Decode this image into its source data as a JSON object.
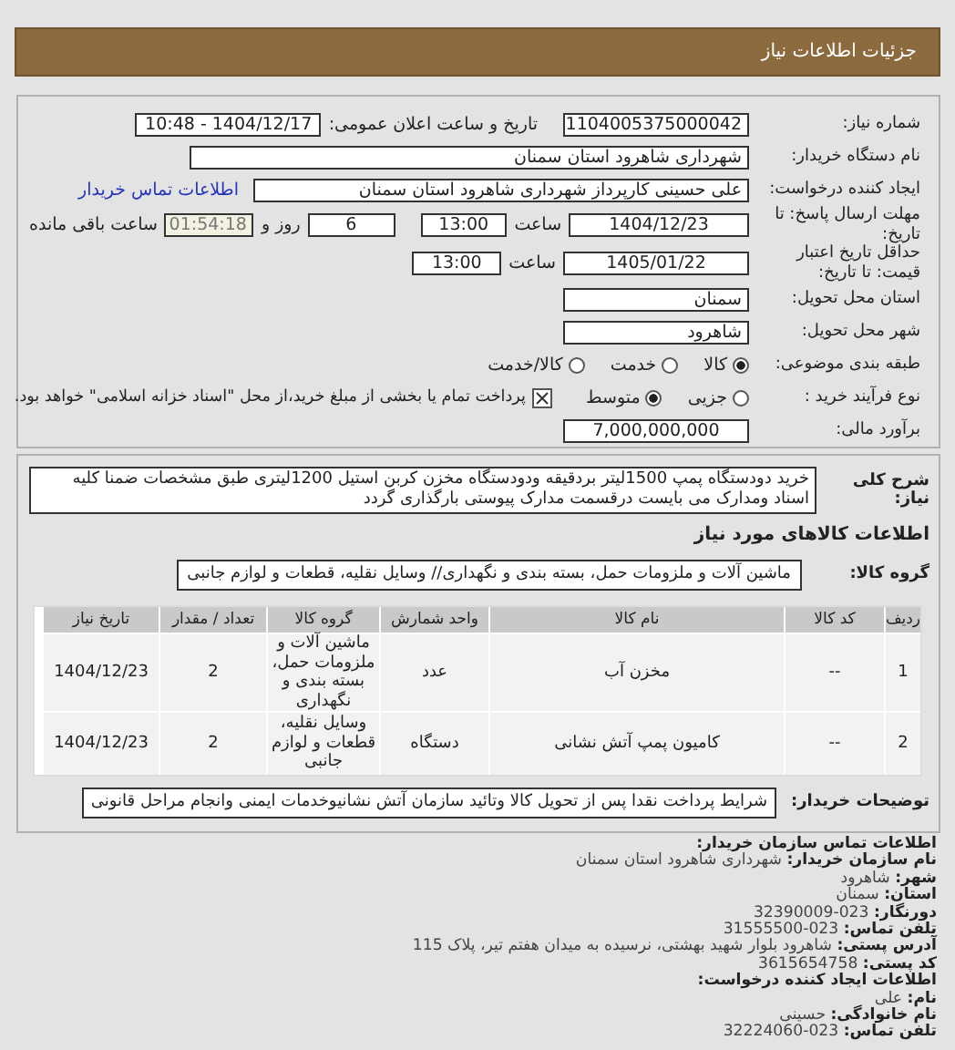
{
  "header": {
    "title": "جزئیات اطلاعات نیاز"
  },
  "need_number": {
    "label": "شماره نیاز:",
    "value": "1104005375000042"
  },
  "announce": {
    "label": "تاریخ و ساعت اعلان عمومی:",
    "value": "1404/12/17 - 10:48"
  },
  "buyer": {
    "label": "نام دستگاه خریدار:",
    "value": "شهرداری شاهرود استان سمنان"
  },
  "requester": {
    "label": "ایجاد کننده درخواست:",
    "value": "علی حسینی کارپرداز شهرداری شاهرود استان سمنان",
    "link": "اطلاعات تماس خریدار"
  },
  "deadline": {
    "label": "مهلت ارسال پاسخ: تا تاریخ:",
    "date": "1404/12/23",
    "time_label": "ساعت",
    "time": "13:00",
    "days": "6",
    "days_label": "روز و",
    "remaining": "01:54:18",
    "remaining_label": "ساعت باقی مانده"
  },
  "validity": {
    "label": "حداقل تاریخ اعتبار قیمت: تا تاریخ:",
    "date": "1405/01/22",
    "time_label": "ساعت",
    "time": "13:00"
  },
  "province": {
    "label": "استان محل تحویل:",
    "value": "سمنان"
  },
  "city": {
    "label": "شهر محل تحویل:",
    "value": "شاهرود"
  },
  "category": {
    "label": "طبقه بندی موضوعی:",
    "options": [
      {
        "label": "کالا",
        "selected": true
      },
      {
        "label": "خدمت",
        "selected": false
      },
      {
        "label": "کالا/خدمت",
        "selected": false
      }
    ]
  },
  "process": {
    "label": "نوع فرآیند خرید :",
    "options": [
      {
        "label": "جزیی",
        "selected": false
      },
      {
        "label": "متوسط",
        "selected": true
      }
    ],
    "treasury": {
      "checked": true,
      "label": "پرداخت تمام یا بخشی از مبلغ خرید،از محل \"اسناد خزانه اسلامی\" خواهد بود."
    }
  },
  "budget": {
    "label": "برآورد مالی:",
    "value": "7,000,000,000"
  },
  "description": {
    "label": "شرح کلی نیاز:",
    "value": "خرید دودستگاه پمپ 1500لیتر بردقیقه ودودستگاه مخزن کربن استیل 1200لیتری طبق مشخصات ضمنا کلیه اسناد ومدارک می بایست درقسمت مدارک پیوستی بارگذاری گردد"
  },
  "goods_heading": "اطلاعات کالاهای مورد نیاز",
  "goods_group": {
    "label": "گروه کالا:",
    "value": "ماشین آلات و ملزومات حمل، بسته بندی و نگهداری// وسایل نقلیه، قطعات و لوازم جانبی"
  },
  "table": {
    "columns": [
      "ردیف",
      "کد کالا",
      "نام کالا",
      "واحد شمارش",
      "گروه کالا",
      "تعداد / مقدار",
      "تاریخ نیاز"
    ],
    "rows": [
      [
        "1",
        "--",
        "مخزن آب",
        "عدد",
        "ماشین آلات و ملزومات حمل، بسته بندی و نگهداری",
        "2",
        "1404/12/23"
      ],
      [
        "2",
        "--",
        "کامیون پمپ آتش نشانی",
        "دستگاه",
        "وسایل نقلیه، قطعات و لوازم جانبی",
        "2",
        "1404/12/23"
      ]
    ]
  },
  "notes": {
    "label": "توضیحات خریدار:",
    "value": "شرایط پرداخت نقدا پس از تحویل کالا وتائید سازمان آتش نشانیوخدمات ایمنی وانجام مراحل قانونی"
  },
  "contact": [
    {
      "kind": "heading",
      "text": "اطلاعات تماس سازمان خریدار:"
    },
    {
      "kind": "item",
      "text": "**نام سازمان خریدار:** شهرداری شاهرود استان سمنان"
    },
    {
      "kind": "item",
      "text": "**شهر:** شاهرود"
    },
    {
      "kind": "item",
      "text": "**استان:** سمنان"
    },
    {
      "kind": "item",
      "text": "**دورنگار:** 023-32390009"
    },
    {
      "kind": "item",
      "text": "**تلفن تماس:** 023-31555500"
    },
    {
      "kind": "item",
      "text": "**آدرس پستی:** شاهرود بلوار شهید بهشتی، نرسیده به میدان هفتم تیر، پلاک 115"
    },
    {
      "kind": "item",
      "text": "**کد پستی:** 3615654758"
    },
    {
      "kind": "heading",
      "text": "اطلاعات ایجاد کننده درخواست:"
    },
    {
      "kind": "item",
      "text": "**نام:** علی"
    },
    {
      "kind": "item",
      "text": "**نام خانوادگی:** حسینی"
    },
    {
      "kind": "item",
      "text": "**تلفن تماس:** 023-32224060"
    }
  ]
}
